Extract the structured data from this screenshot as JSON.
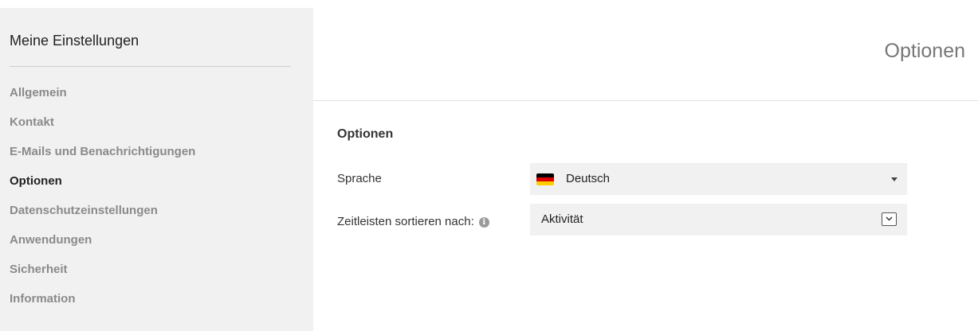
{
  "sidebar": {
    "title": "Meine Einstellungen",
    "items": [
      {
        "label": "Allgemein",
        "active": false
      },
      {
        "label": "Kontakt",
        "active": false
      },
      {
        "label": "E-Mails und Benachrichtigungen",
        "active": false
      },
      {
        "label": "Optionen",
        "active": true
      },
      {
        "label": "Datenschutzeinstellungen",
        "active": false
      },
      {
        "label": "Anwendungen",
        "active": false
      },
      {
        "label": "Sicherheit",
        "active": false
      },
      {
        "label": "Information",
        "active": false
      }
    ]
  },
  "main": {
    "page_title": "Optionen",
    "section_title": "Optionen",
    "language": {
      "label": "Sprache",
      "value": "Deutsch",
      "flag_icon": "german-flag-icon",
      "flag_colors": [
        "#000000",
        "#dd0000",
        "#ffce00"
      ]
    },
    "timeline_sort": {
      "label": "Zeitleisten sortieren nach:",
      "info_icon": "info-icon",
      "value": "Aktivität"
    }
  },
  "colors": {
    "sidebar_bg": "#f1f1f2",
    "select_bg": "#f1f1f2",
    "inactive_nav": "#8a8a8a",
    "active_nav": "#222222"
  }
}
